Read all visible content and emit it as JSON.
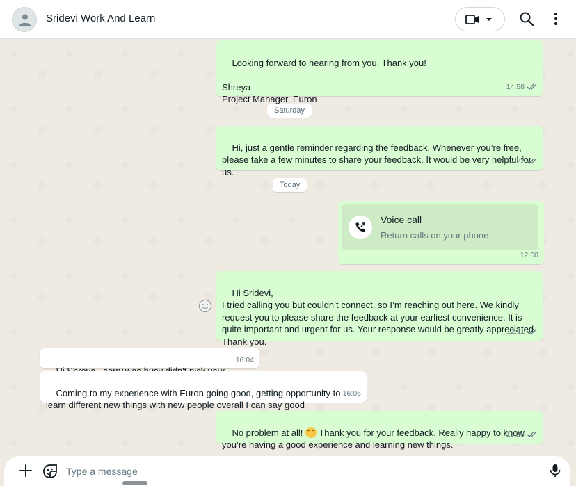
{
  "header": {
    "title": "Sridevi Work And Learn",
    "avatar_icon": "person-icon",
    "video_icon": "video-camera-icon",
    "search_icon": "search-icon",
    "menu_icon": "kebab-menu-icon"
  },
  "messages": [
    {
      "id": "m1",
      "dir": "out",
      "text": "Looking forward to hearing from you. Thank you!\n\nShreya\nProject Manager, Euron",
      "time": "14:58"
    },
    {
      "id": "d1",
      "day": "Saturday"
    },
    {
      "id": "m2",
      "dir": "out",
      "text": "Hi, just a gentle reminder regarding the feedback. Whenever you’re free, please take a few minutes to share your feedback. It would be very helpful for us.",
      "time": "17:22"
    },
    {
      "id": "d2",
      "day": "Today"
    },
    {
      "id": "m3",
      "dir": "out",
      "type": "call",
      "call_title": "Voice call",
      "call_sub": "Return calls on your phone",
      "time": "12:00"
    },
    {
      "id": "m4",
      "dir": "out",
      "text": "Hi Sridevi,\nI tried calling you but couldn’t connect, so I’m reaching out here. We kindly request you to please share the feedback at your earliest convenience. It is quite important and urgent for us. Your response would be greatly appreciated. Thank you.",
      "time": "12:11"
    },
    {
      "id": "m5",
      "dir": "in",
      "text": "Hi Shreya , sorry,was busy didn't pick your call",
      "time": "16:04"
    },
    {
      "id": "m6",
      "dir": "in",
      "text": "Coming to my experience with Euron going good, getting opportunity to learn different new things with new people overall I can say good",
      "time": "16:06"
    },
    {
      "id": "m7",
      "dir": "out",
      "text_before": "No problem at all! ",
      "text_after": " Thank you for your feedback. Really happy to know you’re having a good experience and learning new things.",
      "time": "16:28"
    }
  ],
  "composer": {
    "placeholder": "Type a message",
    "plus_icon": "plus-icon",
    "sticker_icon": "sticker-icon",
    "mic_icon": "microphone-icon"
  },
  "colors": {
    "outgoing_bubble": "#d9fdd3",
    "incoming_bubble": "#ffffff",
    "chat_background": "#efeae2"
  }
}
